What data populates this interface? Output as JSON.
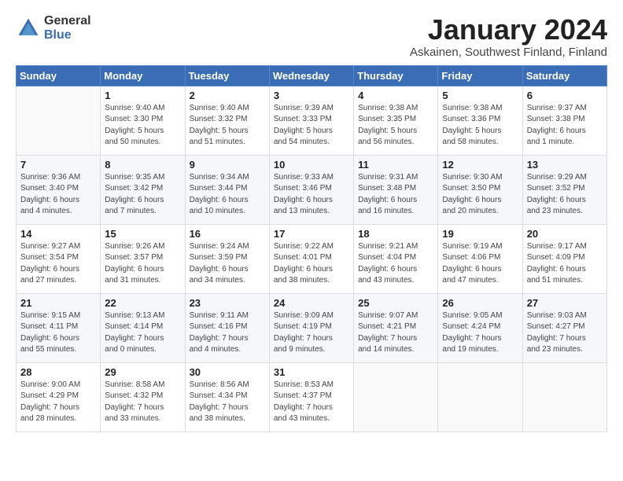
{
  "header": {
    "logo_general": "General",
    "logo_blue": "Blue",
    "title": "January 2024",
    "location": "Askainen, Southwest Finland, Finland"
  },
  "weekdays": [
    "Sunday",
    "Monday",
    "Tuesday",
    "Wednesday",
    "Thursday",
    "Friday",
    "Saturday"
  ],
  "weeks": [
    [
      {
        "day": "",
        "info": ""
      },
      {
        "day": "1",
        "info": "Sunrise: 9:40 AM\nSunset: 3:30 PM\nDaylight: 5 hours\nand 50 minutes."
      },
      {
        "day": "2",
        "info": "Sunrise: 9:40 AM\nSunset: 3:32 PM\nDaylight: 5 hours\nand 51 minutes."
      },
      {
        "day": "3",
        "info": "Sunrise: 9:39 AM\nSunset: 3:33 PM\nDaylight: 5 hours\nand 54 minutes."
      },
      {
        "day": "4",
        "info": "Sunrise: 9:38 AM\nSunset: 3:35 PM\nDaylight: 5 hours\nand 56 minutes."
      },
      {
        "day": "5",
        "info": "Sunrise: 9:38 AM\nSunset: 3:36 PM\nDaylight: 5 hours\nand 58 minutes."
      },
      {
        "day": "6",
        "info": "Sunrise: 9:37 AM\nSunset: 3:38 PM\nDaylight: 6 hours\nand 1 minute."
      }
    ],
    [
      {
        "day": "7",
        "info": "Sunrise: 9:36 AM\nSunset: 3:40 PM\nDaylight: 6 hours\nand 4 minutes."
      },
      {
        "day": "8",
        "info": "Sunrise: 9:35 AM\nSunset: 3:42 PM\nDaylight: 6 hours\nand 7 minutes."
      },
      {
        "day": "9",
        "info": "Sunrise: 9:34 AM\nSunset: 3:44 PM\nDaylight: 6 hours\nand 10 minutes."
      },
      {
        "day": "10",
        "info": "Sunrise: 9:33 AM\nSunset: 3:46 PM\nDaylight: 6 hours\nand 13 minutes."
      },
      {
        "day": "11",
        "info": "Sunrise: 9:31 AM\nSunset: 3:48 PM\nDaylight: 6 hours\nand 16 minutes."
      },
      {
        "day": "12",
        "info": "Sunrise: 9:30 AM\nSunset: 3:50 PM\nDaylight: 6 hours\nand 20 minutes."
      },
      {
        "day": "13",
        "info": "Sunrise: 9:29 AM\nSunset: 3:52 PM\nDaylight: 6 hours\nand 23 minutes."
      }
    ],
    [
      {
        "day": "14",
        "info": "Sunrise: 9:27 AM\nSunset: 3:54 PM\nDaylight: 6 hours\nand 27 minutes."
      },
      {
        "day": "15",
        "info": "Sunrise: 9:26 AM\nSunset: 3:57 PM\nDaylight: 6 hours\nand 31 minutes."
      },
      {
        "day": "16",
        "info": "Sunrise: 9:24 AM\nSunset: 3:59 PM\nDaylight: 6 hours\nand 34 minutes."
      },
      {
        "day": "17",
        "info": "Sunrise: 9:22 AM\nSunset: 4:01 PM\nDaylight: 6 hours\nand 38 minutes."
      },
      {
        "day": "18",
        "info": "Sunrise: 9:21 AM\nSunset: 4:04 PM\nDaylight: 6 hours\nand 43 minutes."
      },
      {
        "day": "19",
        "info": "Sunrise: 9:19 AM\nSunset: 4:06 PM\nDaylight: 6 hours\nand 47 minutes."
      },
      {
        "day": "20",
        "info": "Sunrise: 9:17 AM\nSunset: 4:09 PM\nDaylight: 6 hours\nand 51 minutes."
      }
    ],
    [
      {
        "day": "21",
        "info": "Sunrise: 9:15 AM\nSunset: 4:11 PM\nDaylight: 6 hours\nand 55 minutes."
      },
      {
        "day": "22",
        "info": "Sunrise: 9:13 AM\nSunset: 4:14 PM\nDaylight: 7 hours\nand 0 minutes."
      },
      {
        "day": "23",
        "info": "Sunrise: 9:11 AM\nSunset: 4:16 PM\nDaylight: 7 hours\nand 4 minutes."
      },
      {
        "day": "24",
        "info": "Sunrise: 9:09 AM\nSunset: 4:19 PM\nDaylight: 7 hours\nand 9 minutes."
      },
      {
        "day": "25",
        "info": "Sunrise: 9:07 AM\nSunset: 4:21 PM\nDaylight: 7 hours\nand 14 minutes."
      },
      {
        "day": "26",
        "info": "Sunrise: 9:05 AM\nSunset: 4:24 PM\nDaylight: 7 hours\nand 19 minutes."
      },
      {
        "day": "27",
        "info": "Sunrise: 9:03 AM\nSunset: 4:27 PM\nDaylight: 7 hours\nand 23 minutes."
      }
    ],
    [
      {
        "day": "28",
        "info": "Sunrise: 9:00 AM\nSunset: 4:29 PM\nDaylight: 7 hours\nand 28 minutes."
      },
      {
        "day": "29",
        "info": "Sunrise: 8:58 AM\nSunset: 4:32 PM\nDaylight: 7 hours\nand 33 minutes."
      },
      {
        "day": "30",
        "info": "Sunrise: 8:56 AM\nSunset: 4:34 PM\nDaylight: 7 hours\nand 38 minutes."
      },
      {
        "day": "31",
        "info": "Sunrise: 8:53 AM\nSunset: 4:37 PM\nDaylight: 7 hours\nand 43 minutes."
      },
      {
        "day": "",
        "info": ""
      },
      {
        "day": "",
        "info": ""
      },
      {
        "day": "",
        "info": ""
      }
    ]
  ]
}
